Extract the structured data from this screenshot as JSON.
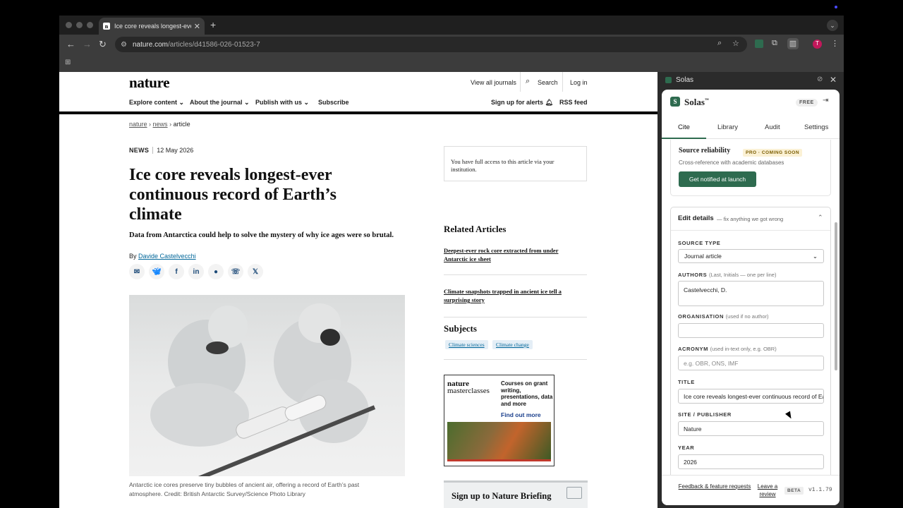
{
  "browser": {
    "tab_title": "Ice core reveals longest-ever c",
    "tab_favicon": "n",
    "url_host": "nature.com",
    "url_path": "/articles/d41586-026-01523-7",
    "profile_initial": "T",
    "profile_color": "#c2185b"
  },
  "site": {
    "logo": "nature",
    "top_links": [
      "View all journals",
      "Search",
      "Log in"
    ],
    "nav": [
      "Explore content",
      "About the journal",
      "Publish with us",
      "Subscribe"
    ],
    "alerts": "Sign up for alerts",
    "rss": "RSS feed"
  },
  "breadcrumb": [
    "nature",
    "news",
    "article"
  ],
  "article": {
    "type": "NEWS",
    "date": "12 May 2026",
    "title": "Ice core reveals longest-ever continuous record of Earth’s climate",
    "standfirst": "Data from Antarctica could help to solve the mystery of why ice ages were so brutal.",
    "byline_prefix": "By",
    "author": "Davide Castelvecchi",
    "caption": "Antarctic ice cores preserve tiny bubbles of ancient air, offering a record of Earth’s past atmosphere.  Credit: British Antarctic Survey/Science Photo Library"
  },
  "sidebar_article": {
    "access_text": "You have full access to this article via your institution.",
    "related_heading": "Related Articles",
    "related": [
      "Deepest-ever rock core extracted from under Antarctic ice sheet",
      "Climate snapshots trapped in ancient ice tell a surprising story"
    ],
    "subjects_heading": "Subjects",
    "subjects": [
      "Climate sciences",
      "Climate change"
    ],
    "ad": {
      "brand_line1": "nature",
      "brand_line2": "masterclasses",
      "copy": "Courses on grant writing, presentations, data and more",
      "cta": "Find out more"
    },
    "briefing": "Sign up to Nature Briefing"
  },
  "side_panel": {
    "title": "Solas",
    "app_name": "Solas",
    "plan_badge": "FREE",
    "tabs": [
      "Cite",
      "Library",
      "Audit",
      "Settings"
    ],
    "reliability": {
      "heading": "Source reliability",
      "badge": "PRO · COMING SOON",
      "sub": "Cross-reference with academic databases",
      "button": "Get notified at launch"
    },
    "edit": {
      "heading": "Edit details",
      "sub": "— fix anything we got wrong",
      "source_type_label": "SOURCE TYPE",
      "source_type_value": "Journal article",
      "authors_label": "AUTHORS",
      "authors_hint": "(Last, Initials — one per line)",
      "authors_value": "Castelvecchi, D.",
      "org_label": "ORGANISATION",
      "org_hint": "(used if no author)",
      "org_value": "",
      "acronym_label": "ACRONYM",
      "acronym_hint": "(used in-text only, e.g. OBR)",
      "acronym_placeholder": "e.g. OBR, ONS, IMF",
      "title_label": "TITLE",
      "title_value": "Ice core reveals longest-ever continuous record of Earth’s climate",
      "publisher_label": "SITE / PUBLISHER",
      "publisher_value": "Nature",
      "year_label": "YEAR",
      "year_value": "2026"
    },
    "footer": {
      "feedback": "Feedback & feature requests",
      "separator": "·",
      "review": "Leave a review",
      "beta": "BETA",
      "version": "v1.1.79"
    },
    "accent_color": "#2e6b4f"
  }
}
